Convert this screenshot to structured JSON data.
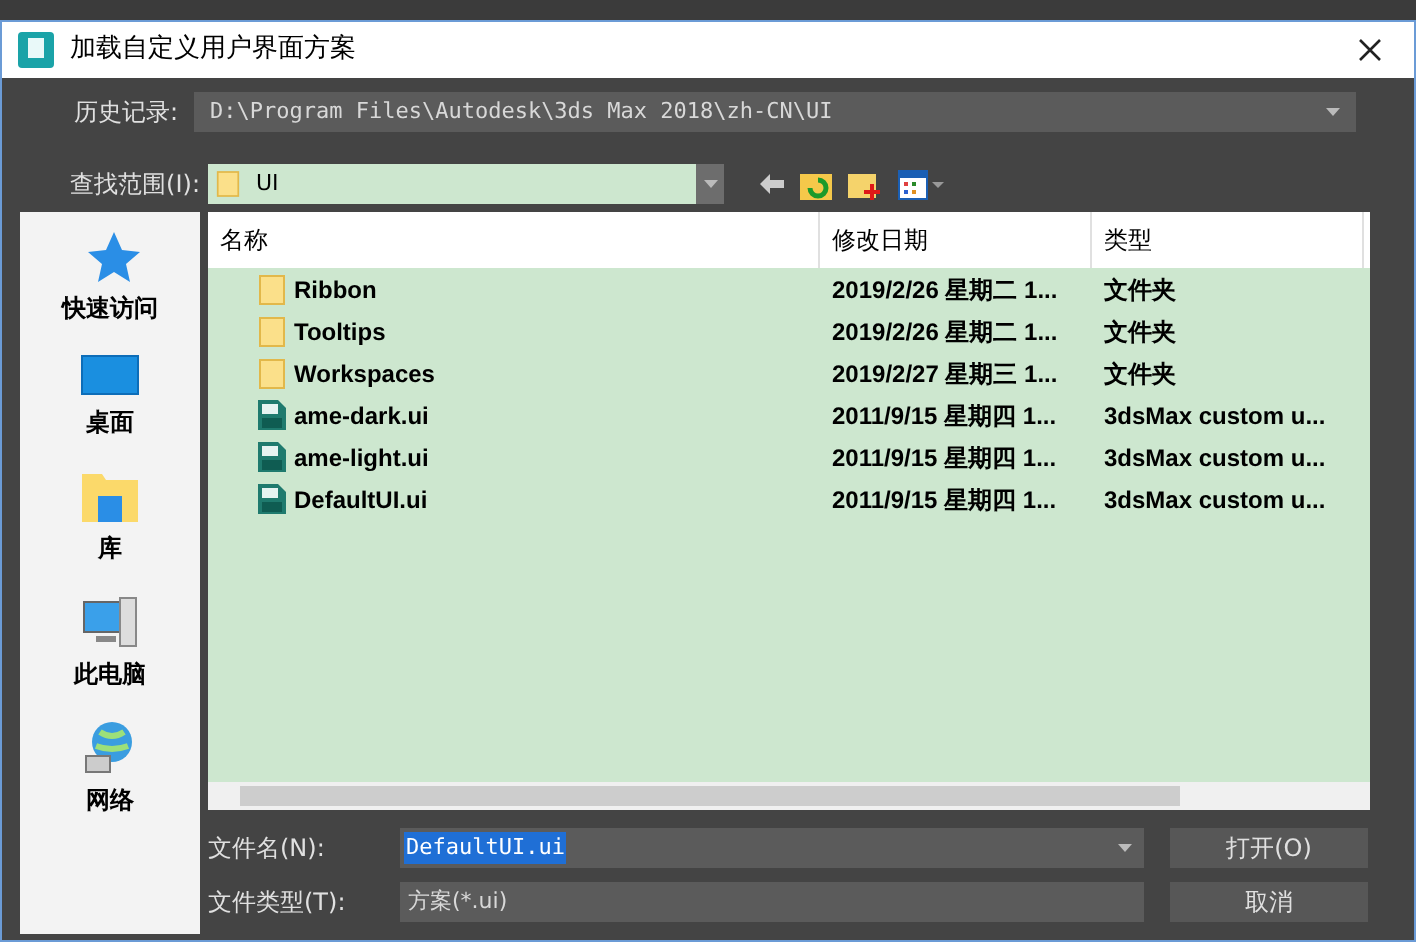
{
  "window": {
    "title": "加载自定义用户界面方案"
  },
  "history": {
    "label": "历史记录:",
    "value": "D:\\Program Files\\Autodesk\\3ds Max 2018\\zh-CN\\UI"
  },
  "look_in": {
    "label": "查找范围(I):",
    "value": "UI"
  },
  "sidebar": {
    "items": [
      {
        "kind": "star",
        "label": "快速访问"
      },
      {
        "kind": "desktop",
        "label": "桌面"
      },
      {
        "kind": "library",
        "label": "库"
      },
      {
        "kind": "computer",
        "label": "此电脑"
      },
      {
        "kind": "network",
        "label": "网络"
      }
    ]
  },
  "table": {
    "columns": [
      "名称",
      "修改日期",
      "类型"
    ],
    "rows": [
      {
        "kind": "folder",
        "name": "Ribbon",
        "date": "2019/2/26 星期二 1...",
        "type": "文件夹"
      },
      {
        "kind": "folder",
        "name": "Tooltips",
        "date": "2019/2/26 星期二 1...",
        "type": "文件夹"
      },
      {
        "kind": "folder",
        "name": "Workspaces",
        "date": "2019/2/27 星期三 1...",
        "type": "文件夹"
      },
      {
        "kind": "file",
        "name": "ame-dark.ui",
        "date": "2011/9/15 星期四 1...",
        "type": "3dsMax custom u..."
      },
      {
        "kind": "file",
        "name": "ame-light.ui",
        "date": "2011/9/15 星期四 1...",
        "type": "3dsMax custom u..."
      },
      {
        "kind": "file",
        "name": "DefaultUI.ui",
        "date": "2011/9/15 星期四 1...",
        "type": "3dsMax custom u..."
      }
    ]
  },
  "file_name": {
    "label": "文件名(N):",
    "value": "DefaultUI.ui"
  },
  "file_type": {
    "label": "文件类型(T):",
    "value": "方案(*.ui)"
  },
  "buttons": [
    "打开(O)",
    "取消"
  ]
}
